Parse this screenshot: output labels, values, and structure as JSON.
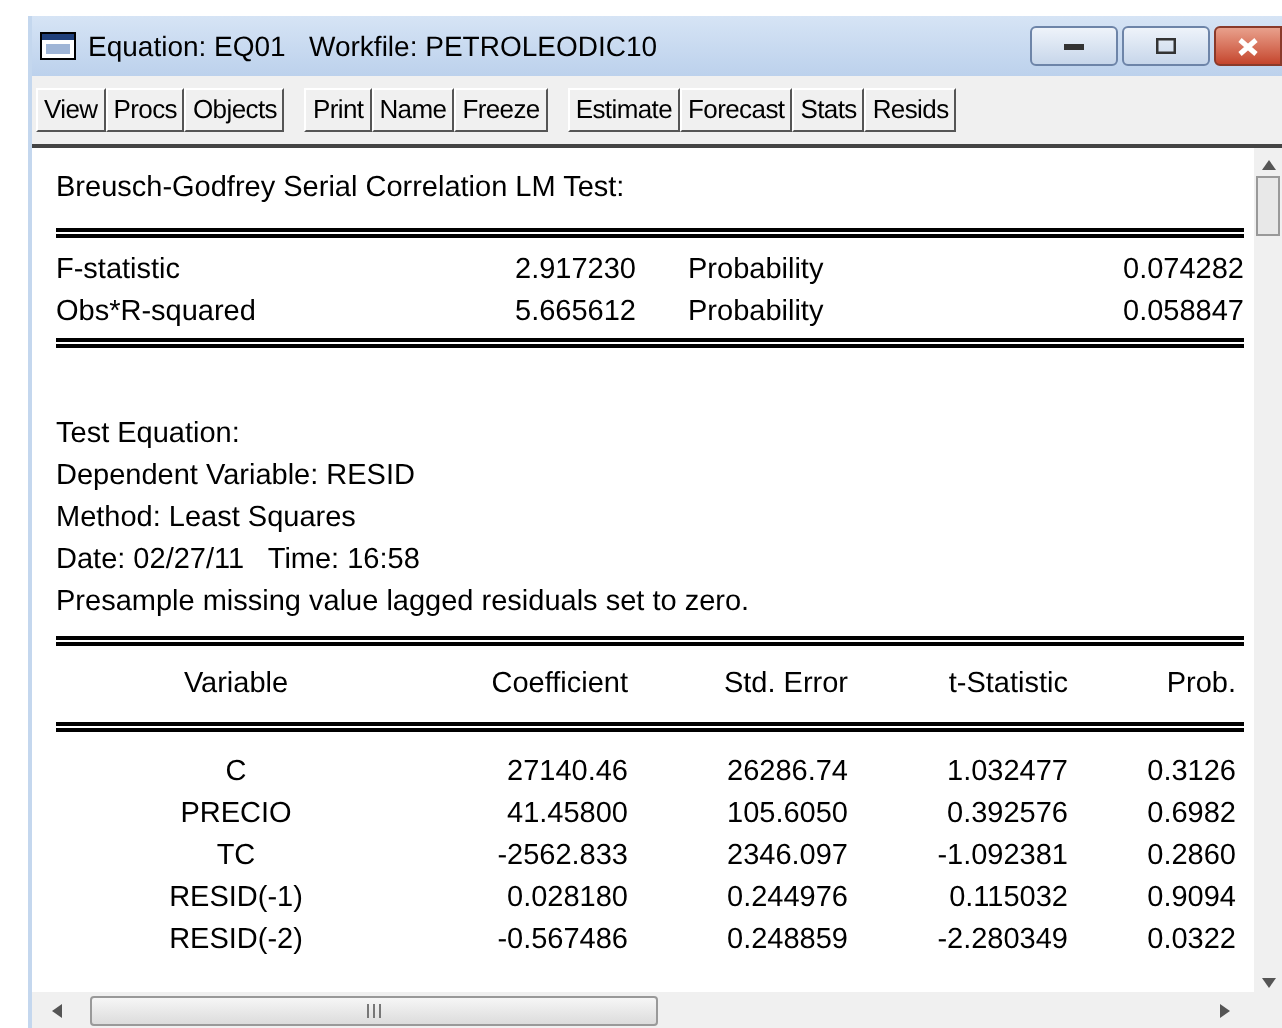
{
  "window": {
    "title": "Equation: EQ01   Workfile: PETROLEODIC10"
  },
  "toolbar": [
    [
      "View",
      "Procs",
      "Objects"
    ],
    [
      "Print",
      "Name",
      "Freeze"
    ],
    [
      "Estimate",
      "Forecast",
      "Stats",
      "Resids"
    ]
  ],
  "heading": "Breusch-Godfrey Serial Correlation LM Test:",
  "statistics": [
    {
      "label": "F-statistic",
      "value": "2.917230",
      "prob_label": "Probability",
      "prob": "0.074282"
    },
    {
      "label": "Obs*R-squared",
      "value": "5.665612",
      "prob_label": "Probability",
      "prob": "0.058847"
    }
  ],
  "test_info": [
    "Test Equation:",
    "Dependent Variable: RESID",
    "Method: Least Squares",
    "Date: 02/27/11   Time: 16:58",
    "Presample missing value lagged residuals set to zero."
  ],
  "table": {
    "columns": [
      "Variable",
      "Coefficient",
      "Std. Error",
      "t-Statistic",
      "Prob."
    ],
    "rows": [
      [
        "C",
        "27140.46",
        "26286.74",
        "1.032477",
        "0.3126"
      ],
      [
        "PRECIO",
        "41.45800",
        "105.6050",
        "0.392576",
        "0.6982"
      ],
      [
        "TC",
        "-2562.833",
        "2346.097",
        "-1.092381",
        "0.2860"
      ],
      [
        "RESID(-1)",
        "0.028180",
        "0.244976",
        "0.115032",
        "0.9094"
      ],
      [
        "RESID(-2)",
        "-0.567486",
        "0.248859",
        "-2.280349",
        "0.0322"
      ]
    ]
  }
}
